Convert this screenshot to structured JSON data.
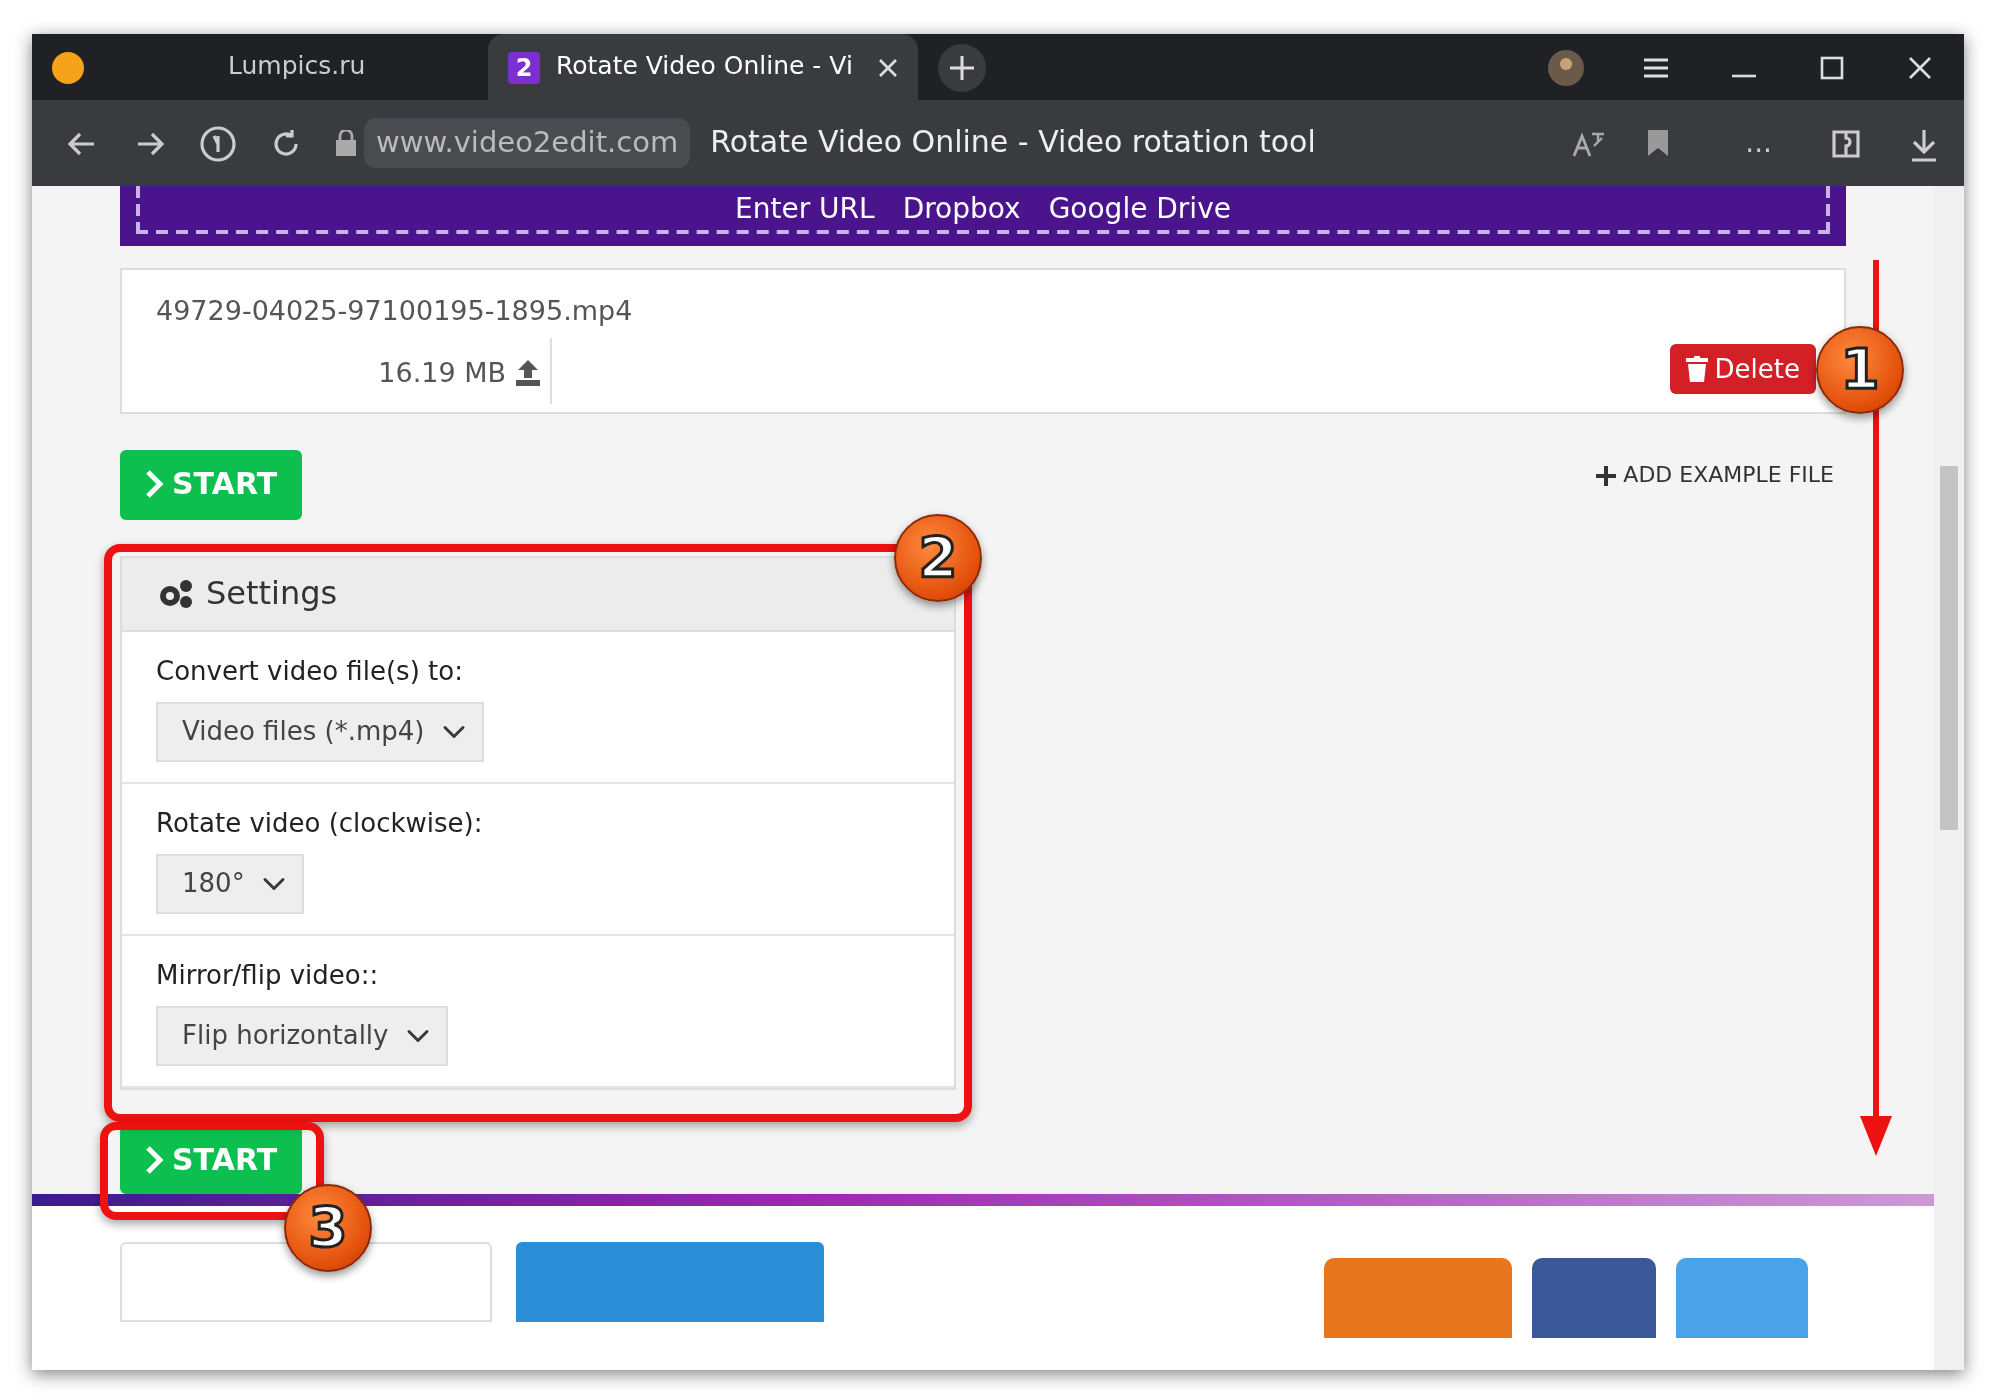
{
  "browser": {
    "tabs": [
      {
        "title": "Lumpics.ru",
        "selected": false
      },
      {
        "title": "Rotate Video Online - Vi",
        "favicon": "2",
        "selected": true
      }
    ],
    "address": {
      "domain": "www.video2edit.com",
      "page_title": "Rotate Video Online - Video rotation tool"
    },
    "more_label": "..."
  },
  "upload": {
    "sources": [
      "Enter URL",
      "Dropbox",
      "Google Drive"
    ]
  },
  "file": {
    "name": "49729-04025-97100195-1895.mp4",
    "size": "16.19 MB",
    "delete_label": "Delete"
  },
  "start_top": "START",
  "add_example": "ADD EXAMPLE FILE",
  "settings": {
    "title": "Settings",
    "fields": [
      {
        "label": "Convert video file(s) to:",
        "value": "Video files (*.mp4)"
      },
      {
        "label": "Rotate video (clockwise):",
        "value": "180°"
      },
      {
        "label": "Mirror/flip video::",
        "value": "Flip horizontally"
      }
    ]
  },
  "start_bottom": "START",
  "annotations": [
    "1",
    "2",
    "3"
  ]
}
